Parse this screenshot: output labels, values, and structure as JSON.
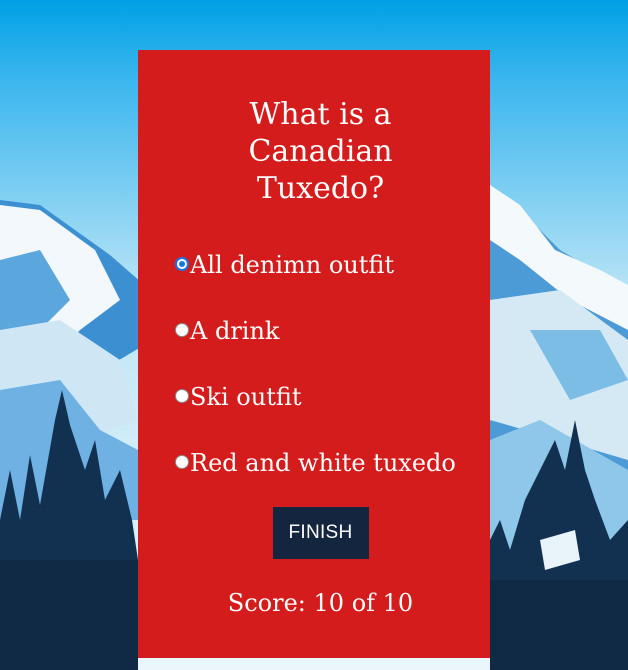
{
  "quiz": {
    "question": "What is a Canadian Tuxedo?",
    "options": [
      {
        "label": "All denimn outfit",
        "selected": true
      },
      {
        "label": "A drink",
        "selected": false
      },
      {
        "label": "Ski outfit",
        "selected": false
      },
      {
        "label": "Red and white tuxedo",
        "selected": false
      }
    ],
    "finish_label": "FINISH",
    "score_text": "Score: 10 of 10"
  },
  "colors": {
    "card": "#d41c1c",
    "button": "#14253f",
    "sky": "#00a2e8",
    "snow": "#eef6fb",
    "trees": "#102a45"
  },
  "background": {
    "scene": "snowy-mountains-with-pine-trees"
  }
}
